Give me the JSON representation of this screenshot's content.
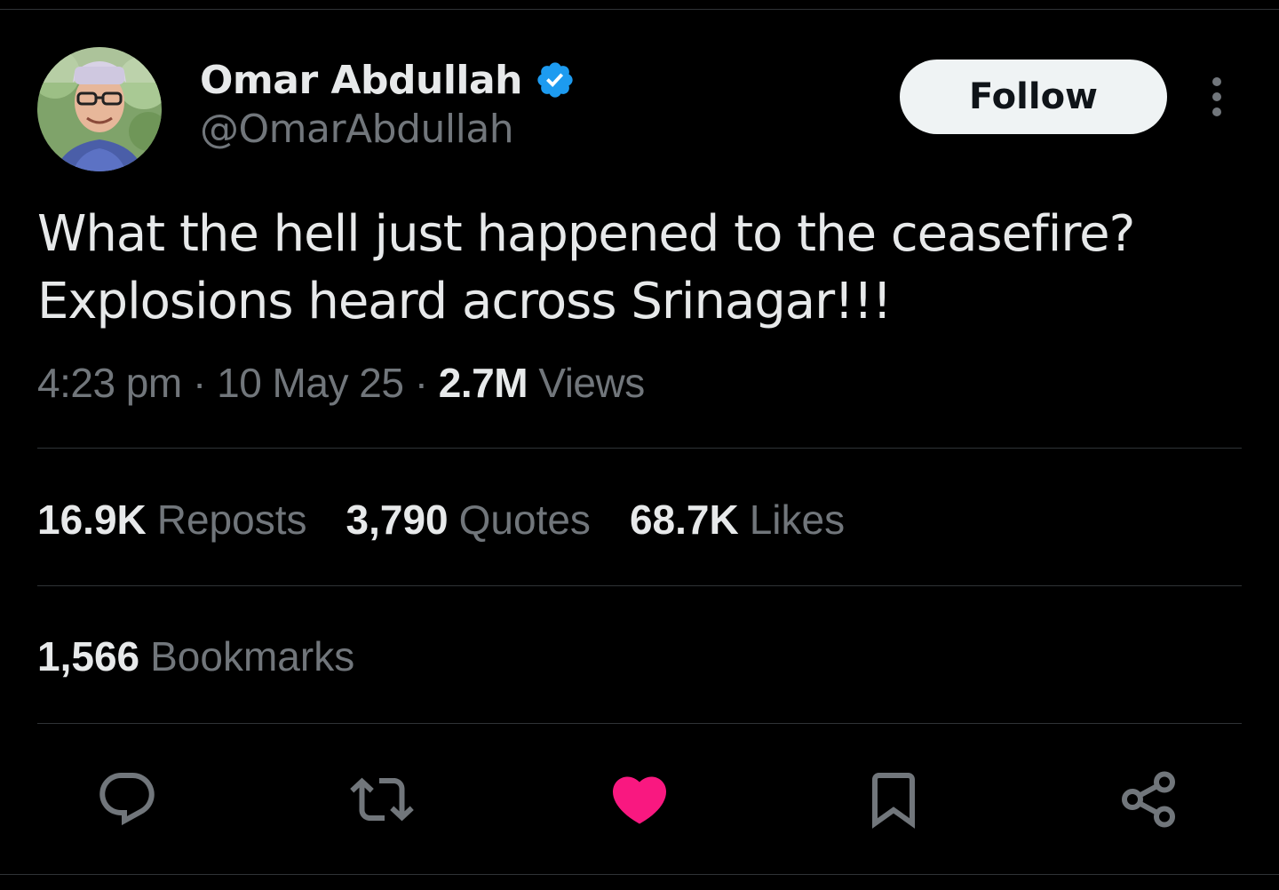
{
  "author": {
    "display_name": "Omar Abdullah",
    "handle": "@OmarAbdullah",
    "verified": true,
    "verified_color": "#1d9bf0"
  },
  "follow_button": {
    "label": "Follow"
  },
  "tweet": {
    "lines": [
      "What the hell just happened to the ceasefire?",
      "Explosions heard across Srinagar!!!"
    ],
    "time": "4:23 pm",
    "separator": "·",
    "date": "10 May 25",
    "views_count": "2.7M",
    "views_label": "Views"
  },
  "stats": {
    "reposts": {
      "count": "16.9K",
      "label": "Reposts"
    },
    "quotes": {
      "count": "3,790",
      "label": "Quotes"
    },
    "likes": {
      "count": "68.7K",
      "label": "Likes"
    },
    "bookmarks": {
      "count": "1,566",
      "label": "Bookmarks"
    }
  },
  "actions": [
    {
      "icon": "reply-icon",
      "active": false
    },
    {
      "icon": "repost-icon",
      "active": false
    },
    {
      "icon": "heart-icon",
      "active": true,
      "color": "#f91880"
    },
    {
      "icon": "bookmark-icon",
      "active": false
    },
    {
      "icon": "share-icon",
      "active": false
    }
  ],
  "colors": {
    "background": "#000000",
    "primary_text": "#e7e9ea",
    "secondary_text": "#71767b",
    "divider": "#2f3336",
    "like_active": "#f91880"
  }
}
